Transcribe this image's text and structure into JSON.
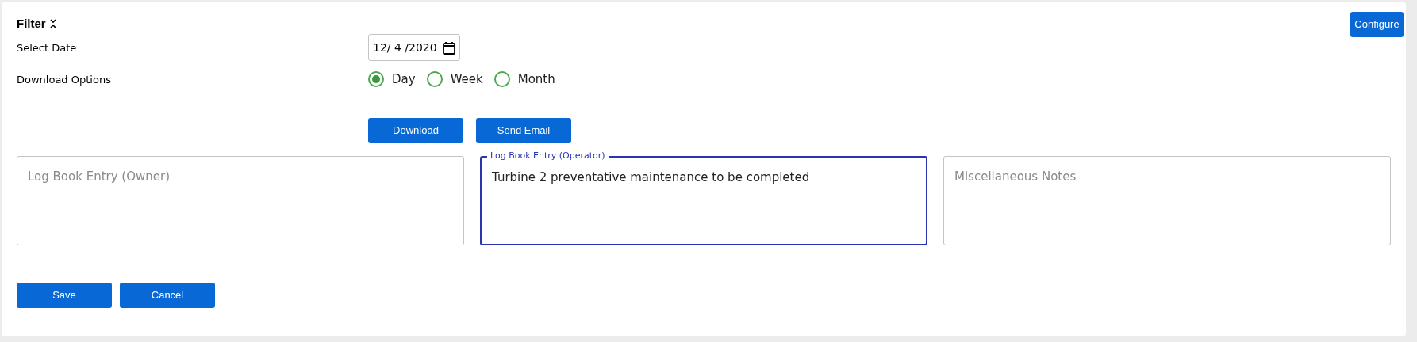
{
  "filter": {
    "title": "Filter",
    "expanded": true
  },
  "configure_button": "Configure",
  "select_date": {
    "label": "Select Date",
    "value": "12/ 4 /2020"
  },
  "download_options": {
    "label": "Download Options",
    "options": [
      {
        "label": "Day",
        "selected": true
      },
      {
        "label": "Week",
        "selected": false
      },
      {
        "label": "Month",
        "selected": false
      }
    ]
  },
  "action_buttons": [
    "Download",
    "Send Email"
  ],
  "notes": [
    {
      "placeholder": "Log Book Entry (Owner)",
      "focused": false
    },
    {
      "label": "Log Book Entry (Operator)",
      "value": "Turbine 2 preventative maintenance to be completed",
      "focused": true
    },
    {
      "placeholder": "Miscellaneous Notes",
      "focused": false
    }
  ],
  "form_buttons": [
    "Save",
    "Cancel"
  ]
}
